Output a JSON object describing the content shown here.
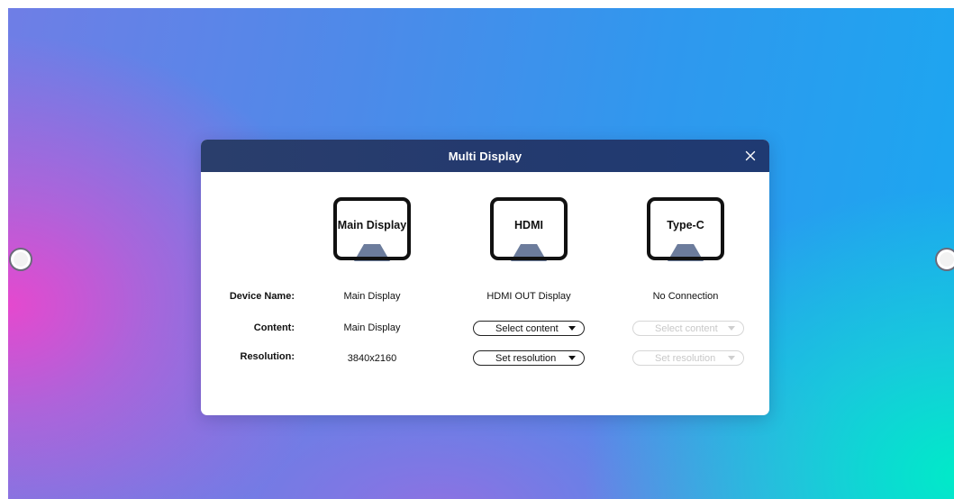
{
  "dialog": {
    "title": "Multi Display",
    "close_icon": "close-icon"
  },
  "displays": [
    {
      "monitor_label": "Main Display",
      "device_name": "Main Display",
      "content": "Main Display",
      "resolution": "3840x2160"
    },
    {
      "monitor_label": "HDMI",
      "device_name": "HDMI OUT Display",
      "content_placeholder": "Select content",
      "resolution_placeholder": "Set resolution"
    },
    {
      "monitor_label": "Type-C",
      "device_name": "No Connection",
      "content_placeholder": "Select content",
      "resolution_placeholder": "Set resolution"
    }
  ],
  "rows": {
    "device_name_label": "Device Name:",
    "content_label": "Content:",
    "resolution_label": "Resolution:"
  },
  "colors": {
    "header": "#243a6e",
    "monitor_stand": "#6c7c9c"
  },
  "icons": [
    "close-icon",
    "monitor-icon",
    "chevron-down-icon"
  ]
}
